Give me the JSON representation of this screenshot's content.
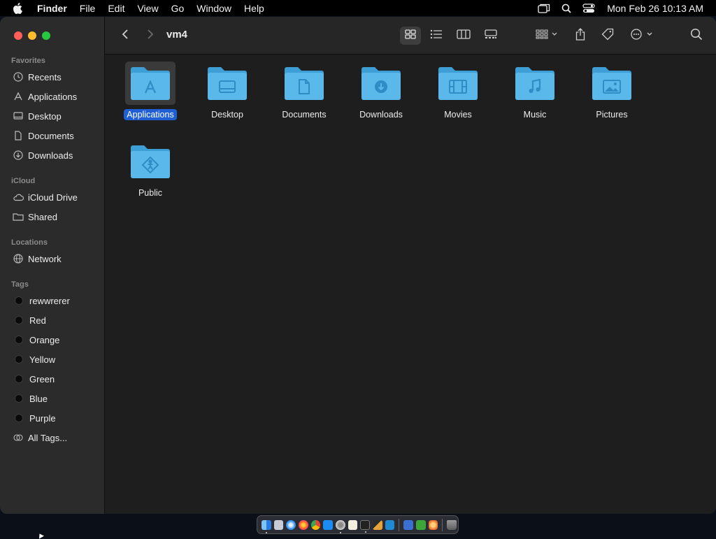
{
  "menubar": {
    "app_name": "Finder",
    "menus": [
      "File",
      "Edit",
      "View",
      "Go",
      "Window",
      "Help"
    ],
    "clock": "Mon Feb 26  10:13 AM",
    "icons": [
      "apple-icon",
      "window-icon",
      "spotlight-icon",
      "control-center-icon"
    ]
  },
  "window": {
    "title": "vm4",
    "traffic_lights": {
      "close": "#ff5f57",
      "minimize": "#febc2e",
      "maximize": "#28c840"
    }
  },
  "sidebar": {
    "favorites_header": "Favorites",
    "favorites": [
      {
        "label": "Recents",
        "icon": "clock-icon"
      },
      {
        "label": "Applications",
        "icon": "apps-icon"
      },
      {
        "label": "Desktop",
        "icon": "desktop-icon"
      },
      {
        "label": "Documents",
        "icon": "document-icon"
      },
      {
        "label": "Downloads",
        "icon": "download-icon"
      }
    ],
    "icloud_header": "iCloud",
    "icloud": [
      {
        "label": "iCloud Drive",
        "icon": "cloud-icon"
      },
      {
        "label": "Shared",
        "icon": "shared-folder-icon"
      }
    ],
    "locations_header": "Locations",
    "locations": [
      {
        "label": "Network",
        "icon": "globe-icon"
      }
    ],
    "tags_header": "Tags",
    "tags": [
      "rewwrerer",
      "Red",
      "Orange",
      "Yellow",
      "Green",
      "Blue",
      "Purple"
    ],
    "all_tags": "All Tags..."
  },
  "toolbar": {
    "icons": [
      "back-icon",
      "forward-icon",
      "icon-view-icon",
      "list-view-icon",
      "column-view-icon",
      "gallery-view-icon",
      "group-icon",
      "share-icon",
      "tag-icon",
      "more-icon",
      "search-icon"
    ],
    "selected_view": "icon-view"
  },
  "folders": [
    {
      "label": "Applications",
      "glyph": "apps",
      "selected": true
    },
    {
      "label": "Desktop",
      "glyph": "desktop",
      "selected": false
    },
    {
      "label": "Documents",
      "glyph": "document",
      "selected": false
    },
    {
      "label": "Downloads",
      "glyph": "download",
      "selected": false
    },
    {
      "label": "Movies",
      "glyph": "film",
      "selected": false
    },
    {
      "label": "Music",
      "glyph": "music",
      "selected": false
    },
    {
      "label": "Pictures",
      "glyph": "picture",
      "selected": false
    },
    {
      "label": "Public",
      "glyph": "public",
      "selected": false
    }
  ],
  "colors": {
    "folder_blue": "#5ab8ea",
    "folder_blue_dark": "#3e9fd6",
    "selection_blue": "#1f5fd3"
  },
  "dock": {
    "apps": [
      "finder-icon",
      "launchpad-icon",
      "safari-icon",
      "firefox-icon",
      "chrome-icon",
      "app-store-icon",
      "settings-icon",
      "notes-icon",
      "terminal-icon",
      "brush-icon",
      "vscode-icon",
      "remote-desktop-icon",
      "minecraft-icon",
      "stack-icon",
      "trash-icon"
    ]
  }
}
